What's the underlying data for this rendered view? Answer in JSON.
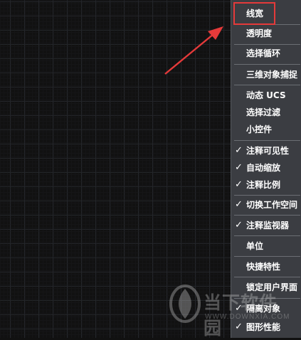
{
  "menu": {
    "items": [
      {
        "label": "线宽",
        "checked": false
      },
      {
        "label": "透明度",
        "checked": false
      },
      {
        "label": "选择循环",
        "checked": false
      },
      {
        "label": "三维对象捕捉",
        "checked": false
      },
      {
        "label": "动态 UCS",
        "checked": false
      },
      {
        "label": "选择过滤",
        "checked": false
      },
      {
        "label": "小控件",
        "checked": false
      },
      {
        "label": "注释可见性",
        "checked": true
      },
      {
        "label": "自动缩放",
        "checked": true
      },
      {
        "label": "注释比例",
        "checked": true
      },
      {
        "label": "切换工作空间",
        "checked": true
      },
      {
        "label": "注释监视器",
        "checked": true
      },
      {
        "label": "单位",
        "checked": false
      },
      {
        "label": "快捷特性",
        "checked": false
      },
      {
        "label": "锁定用户界面",
        "checked": false
      },
      {
        "label": "隔离对象",
        "checked": true
      },
      {
        "label": "图形性能",
        "checked": true
      }
    ],
    "check_glyph": "✓"
  },
  "watermark": {
    "text": "当下软件园",
    "subtext": "WWW.DOWNXIA.COM"
  },
  "colors": {
    "canvas": "#111111",
    "menu_bg": "#3b3d42",
    "highlight": "#e53a3a",
    "arrow": "#e53a3a"
  }
}
